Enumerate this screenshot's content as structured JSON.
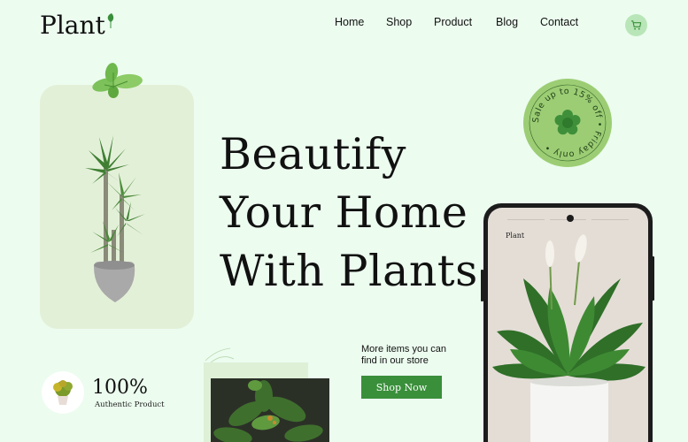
{
  "brand": {
    "name": "Plant"
  },
  "nav": {
    "items": [
      "Home",
      "Shop",
      "Product",
      "Blog",
      "Contact"
    ]
  },
  "header": {
    "cart_icon": "cart-icon"
  },
  "hero": {
    "line1": "Beautify",
    "line2": "Your Home",
    "line3": "With Plants"
  },
  "badge": {
    "text": "Sale up to 15% off • Friday only •",
    "icon": "flower-icon"
  },
  "phone": {
    "logo": "Plant"
  },
  "promo": {
    "text_line1": "More items you can",
    "text_line2": "find in our store",
    "button_label": "Shop Now"
  },
  "stats": {
    "value": "100%",
    "label": "Authentic Product"
  },
  "colors": {
    "background": "#ecfcef",
    "accent": "#3a8f3b",
    "badge": "#9ccd74",
    "card": "#e3f0d8"
  }
}
